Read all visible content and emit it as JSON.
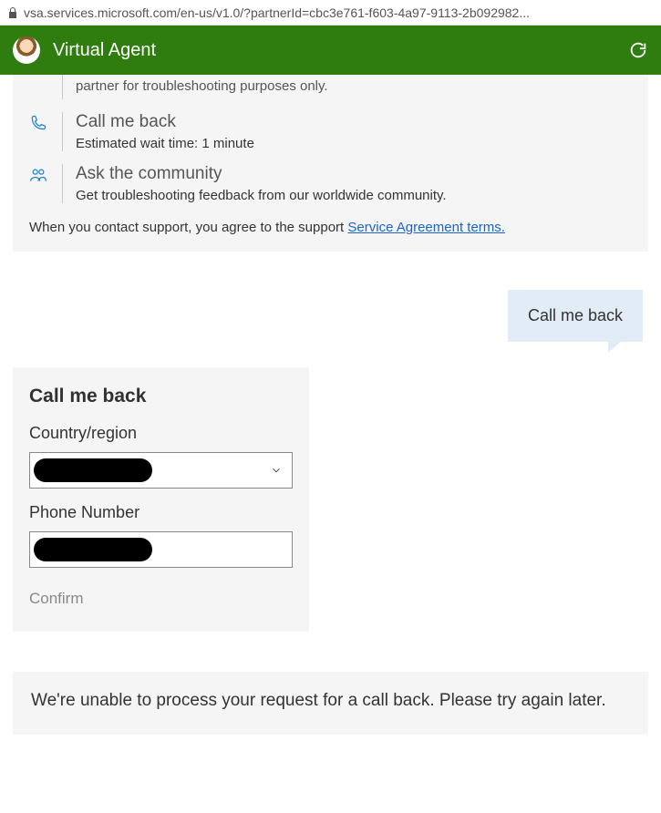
{
  "url": "vsa.services.microsoft.com/en-us/v1.0/?partnerId=cbc3e761-f603-4a97-9113-2b092982...",
  "header": {
    "title": "Virtual Agent"
  },
  "options": {
    "cutoff_text": "partner for troubleshooting purposes only.",
    "callback": {
      "title": "Call me back",
      "sub": "Estimated wait time: 1 minute"
    },
    "community": {
      "title": "Ask the community",
      "sub": "Get troubleshooting feedback from our worldwide community."
    },
    "agreement_prefix": "When you contact support, you agree to the support ",
    "agreement_link": "Service Agreement terms."
  },
  "user_message": "Call me back",
  "form": {
    "title": "Call me back",
    "country_label": "Country/region",
    "phone_label": "Phone Number",
    "confirm_label": "Confirm"
  },
  "error_message": "We're unable to process your request for a call back. Please try again later."
}
